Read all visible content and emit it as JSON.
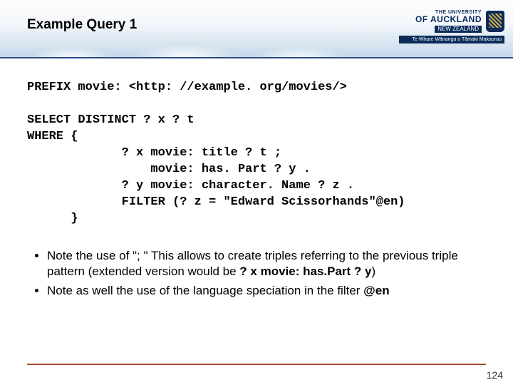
{
  "header": {
    "title": "Example Query 1",
    "logo": {
      "line1": "THE UNIVERSITY",
      "line2": "OF AUCKLAND",
      "line3": "NEW ZEALAND",
      "subline": "Te Whare Wānanga o Tāmaki Makaurau"
    }
  },
  "code": {
    "l1": "PREFIX movie: <http: //example. org/movies/>",
    "l2": "SELECT DISTINCT ? x ? t",
    "l3": "WHERE {",
    "l4": "             ? x movie: title ? t ;",
    "l5": "                 movie: has. Part ? y .",
    "l6": "             ? y movie: character. Name ? z .",
    "l7": "             FILTER (? z = \"Edward Scissorhands\"@en)",
    "l8": "      }"
  },
  "notes": {
    "n1_a": "Note the use of \"; \" This allows to create triples referring to the previous triple pattern (extended version would be ",
    "n1_b": "? x movie: has.Part ? y",
    "n1_c": ")",
    "n2_a": "Note as well the use of the language speciation in the filter ",
    "n2_b": "@en"
  },
  "page_number": "124"
}
